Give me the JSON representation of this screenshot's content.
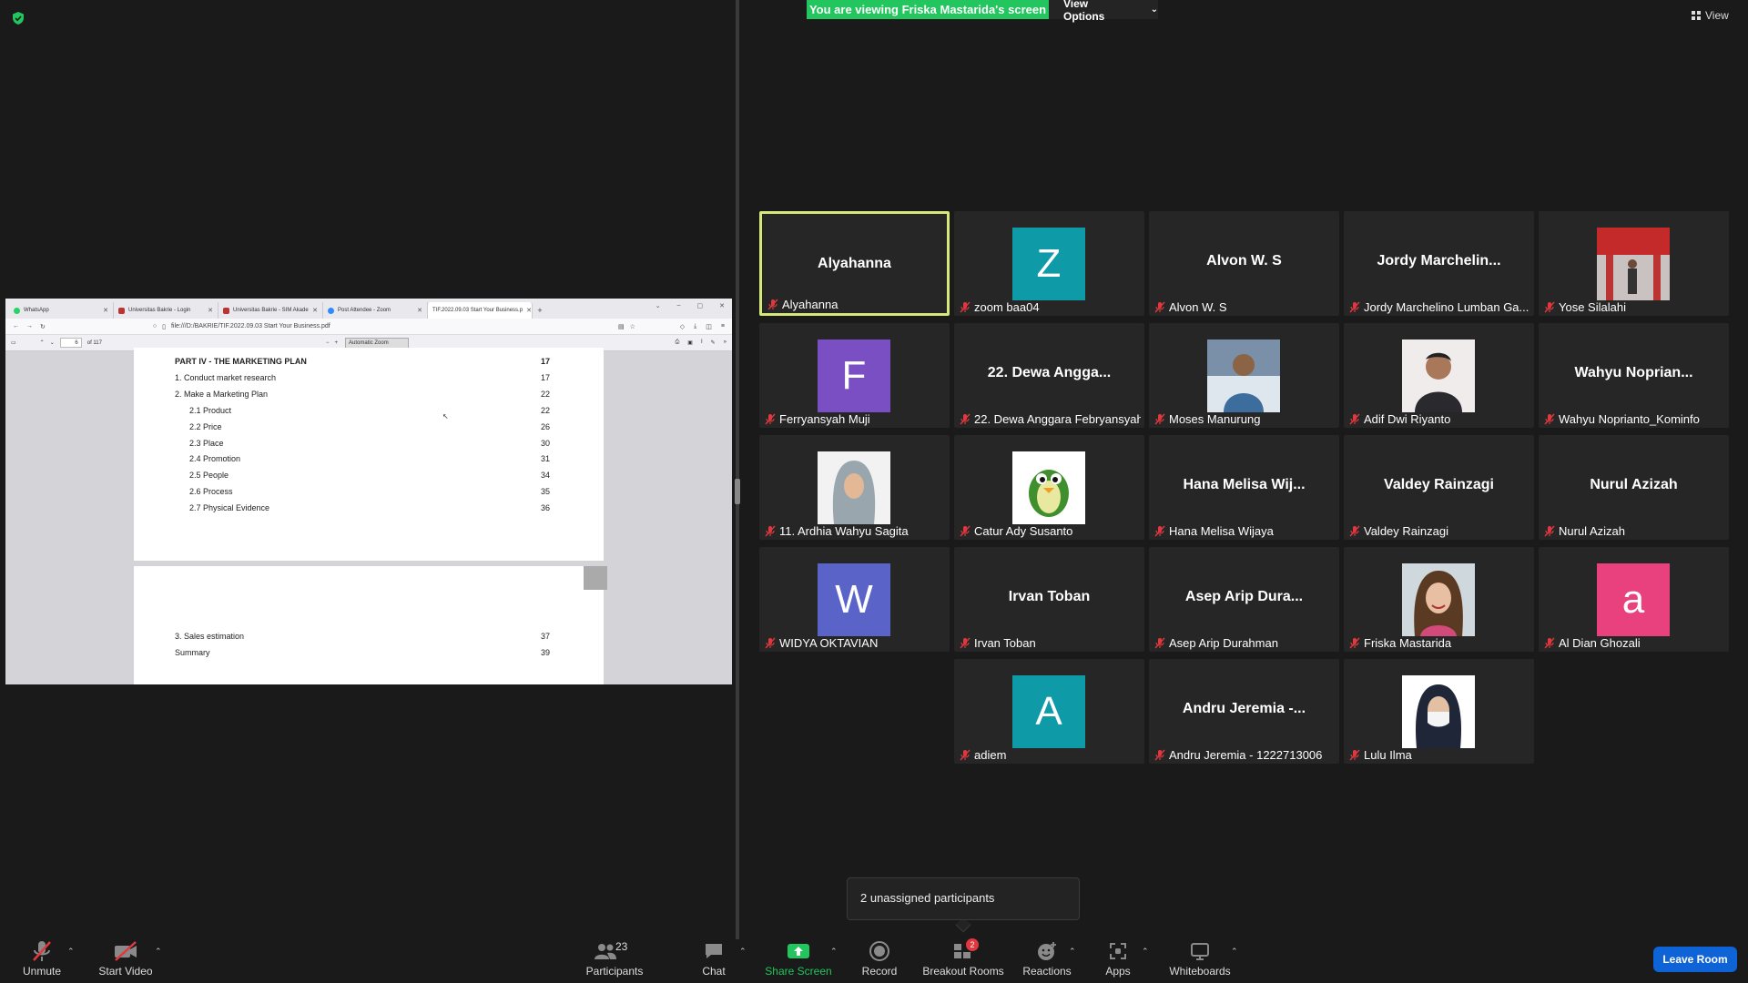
{
  "banner": {
    "viewing_text": "You are viewing Friska Mastarida's screen",
    "view_options_label": "View Options",
    "view_label": "View"
  },
  "colors": {
    "banner_green": "#22c55e",
    "active_speaker_border": "#d5e87a",
    "leave_blue": "#0e63d6",
    "mute_red": "#e0383e"
  },
  "shared_screen": {
    "tabs": [
      {
        "label": "WhatsApp",
        "icon": "whatsapp-icon"
      },
      {
        "label": "Universitas Bakrie - Login",
        "icon": "shield-icon"
      },
      {
        "label": "Universitas Bakrie - SIM Akade",
        "icon": "shield-icon"
      },
      {
        "label": "Post Attendee - Zoom",
        "icon": "zoom-icon"
      },
      {
        "label": "TIF.2022.09.03 Start Your Business.p",
        "icon": "pdf-icon"
      }
    ],
    "url": "file:///D:/BAKRIE/TIF.2022.09.03 Start Your Business.pdf",
    "pdf_page_number": "6",
    "pdf_page_total": "of 117",
    "pdf_zoom": "Automatic Zoom",
    "toc_page1": [
      {
        "label": "PART IV - THE MARKETING PLAN",
        "page": "17"
      },
      {
        "label": "1.    Conduct market research",
        "page": "17"
      },
      {
        "label": "2.    Make a Marketing Plan",
        "page": "22"
      },
      {
        "label": "2.1  Product",
        "page": "22"
      },
      {
        "label": "2.2  Price",
        "page": "26"
      },
      {
        "label": "2.3  Place",
        "page": "30"
      },
      {
        "label": "2.4  Promotion",
        "page": "31"
      },
      {
        "label": "2.5  People",
        "page": "34"
      },
      {
        "label": "2.6  Process",
        "page": "35"
      },
      {
        "label": "2.7  Physical Evidence",
        "page": "36"
      }
    ],
    "toc_page2": [
      {
        "label": "3.    Sales estimation",
        "page": "37"
      },
      {
        "label": "Summary",
        "page": "39"
      }
    ]
  },
  "participants_grid": [
    {
      "display": "Alyahanna",
      "name": "Alyahanna",
      "type": "text",
      "active": true
    },
    {
      "display": "Z",
      "name": "zoom baa04",
      "type": "letter",
      "color": "#0e9aa7"
    },
    {
      "display": "Alvon W. S",
      "name": "Alvon W. S",
      "type": "text"
    },
    {
      "display": "Jordy  Marchelin...",
      "name": "Jordy Marchelino Lumban Ga...",
      "type": "text"
    },
    {
      "display": "",
      "name": "Yose Silalahi",
      "type": "photo",
      "photo": "red-building"
    },
    {
      "display": "F",
      "name": "Ferryansyah Muji",
      "type": "letter",
      "color": "#7b4fc4"
    },
    {
      "display": "22. Dewa Angga...",
      "name": "22. Dewa Anggara Febryansyah",
      "type": "text"
    },
    {
      "display": "",
      "name": "Moses Manurung",
      "type": "photo",
      "photo": "man-blue-shirt"
    },
    {
      "display": "",
      "name": "Adif Dwi Riyanto",
      "type": "photo",
      "photo": "man-dark-shirt"
    },
    {
      "display": "Wahyu  Noprian...",
      "name": "Wahyu Noprianto_Kominfo",
      "type": "text"
    },
    {
      "display": "",
      "name": "11. Ardhia Wahyu Sagita",
      "type": "photo",
      "photo": "woman-hijab-gray"
    },
    {
      "display": "",
      "name": "Catur Ady Susanto",
      "type": "photo",
      "photo": "penguin"
    },
    {
      "display": "Hana  Melisa  Wij...",
      "name": "Hana Melisa Wijaya",
      "type": "text"
    },
    {
      "display": "Valdey  Rainzagi",
      "name": "Valdey Rainzagi",
      "type": "text"
    },
    {
      "display": "Nurul  Azizah",
      "name": "Nurul Azizah",
      "type": "text"
    },
    {
      "display": "W",
      "name": "WIDYA OKTAVIAN",
      "type": "letter",
      "color": "#5a63c8"
    },
    {
      "display": "Irvan  Toban",
      "name": "Irvan Toban",
      "type": "text"
    },
    {
      "display": "Asep  Arip  Dura...",
      "name": "Asep Arip Durahman",
      "type": "text"
    },
    {
      "display": "",
      "name": "Friska Mastarida",
      "type": "photo",
      "photo": "woman-smiling"
    },
    {
      "display": "a",
      "name": "Al Dian Ghozali",
      "type": "letter",
      "color": "#e8417e"
    },
    {
      "display": "A",
      "name": "adiem",
      "type": "letter",
      "color": "#0e9aa7"
    },
    {
      "display": "Andru  Jeremia  -...",
      "name": "Andru Jeremia - 1222713006",
      "type": "text"
    },
    {
      "display": "",
      "name": "Lulu Ilma",
      "type": "photo",
      "photo": "woman-hijab-mask"
    }
  ],
  "unassigned_text": "2 unassigned participants",
  "toolbar": {
    "unmute": "Unmute",
    "start_video": "Start Video",
    "participants": "Participants",
    "participants_count": "23",
    "chat": "Chat",
    "share_screen": "Share Screen",
    "record": "Record",
    "breakout_rooms": "Breakout Rooms",
    "breakout_badge": "2",
    "reactions": "Reactions",
    "apps": "Apps",
    "whiteboards": "Whiteboards",
    "leave_room": "Leave Room"
  }
}
